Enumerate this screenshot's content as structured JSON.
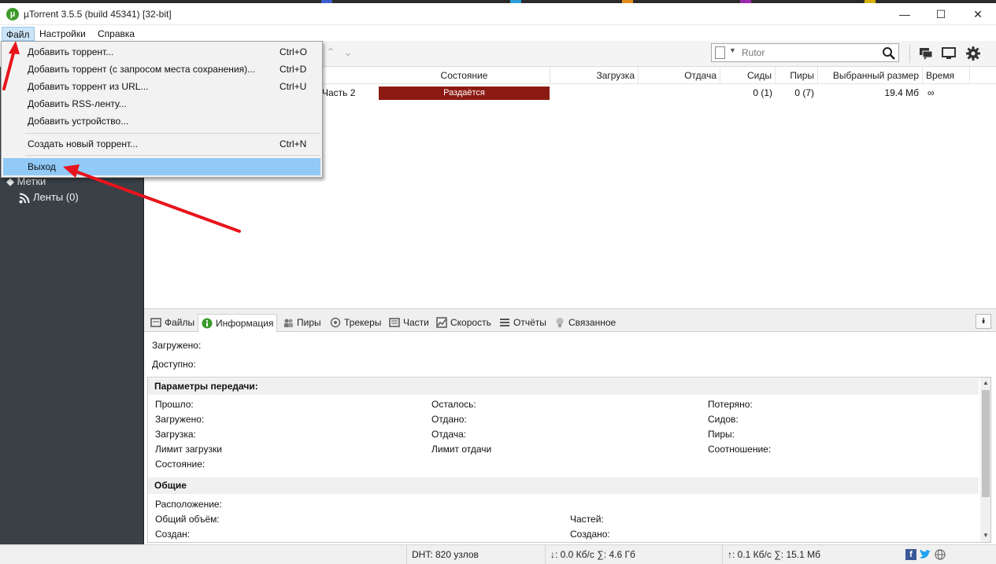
{
  "window": {
    "title": "µTorrent 3.5.5  (build 45341) [32-bit]",
    "minimize": "—",
    "maximize": "☐",
    "close": "✕"
  },
  "menubar": {
    "file": "Файл",
    "settings": "Настройки",
    "help": "Справка"
  },
  "file_menu": {
    "items": [
      {
        "label": "Добавить торрент...",
        "shortcut": "Ctrl+O"
      },
      {
        "label": "Добавить торрент (с запросом места сохранения)...",
        "shortcut": "Ctrl+D"
      },
      {
        "label": "Добавить торрент из URL...",
        "shortcut": "Ctrl+U"
      },
      {
        "label": "Добавить RSS-ленту...",
        "shortcut": ""
      },
      {
        "label": "Добавить устройство...",
        "shortcut": ""
      },
      {
        "label": "Создать новый торрент...",
        "shortcut": "Ctrl+N"
      },
      {
        "label": "Выход",
        "shortcut": ""
      }
    ]
  },
  "search": {
    "placeholder": "Rutor"
  },
  "sidebar": {
    "labels": "Метки",
    "feeds": "Ленты (0)"
  },
  "torrent_list": {
    "columns": {
      "state": "Состояние",
      "download": "Загрузка",
      "upload": "Отдача",
      "seeds": "Сиды",
      "peers": "Пиры",
      "size": "Выбранный размер",
      "time": "Время"
    },
    "row": {
      "name": "Часть 2",
      "state": "Раздаётся",
      "seeds": "0 (1)",
      "peers": "0 (7)",
      "size": "19.4 Мб",
      "time": "∞"
    }
  },
  "tabs": [
    "Файлы",
    "Информация",
    "Пиры",
    "Трекеры",
    "Части",
    "Скорость",
    "Отчёты",
    "Связанное"
  ],
  "info": {
    "downloaded": "Загружено:",
    "available": "Доступно:",
    "transfer_header": "Параметры передачи:",
    "col1": [
      "Прошло:",
      "Загружено:",
      "Загрузка:",
      "Лимит загрузки",
      "Состояние:"
    ],
    "col2": [
      "Осталось:",
      "Отдано:",
      "Отдача:",
      "Лимит отдачи"
    ],
    "col3": [
      "Потеряно:",
      "Сидов:",
      "Пиры:",
      "Соотношение:"
    ],
    "general_header": "Общие",
    "gen_col1": [
      "Расположение:",
      "Общий объём:",
      "Создан:"
    ],
    "gen_col2": [
      "Частей:",
      "Создано:"
    ]
  },
  "statusbar": {
    "dht": "DHT: 820 узлов",
    "down": "↓: 0.0 Кб/с ∑: 4.6 Гб",
    "up": "↑: 0.1 Кб/с ∑: 15.1 Мб"
  },
  "colors": {
    "sidebar": "#394147",
    "seeding": "#8b1a12",
    "highlight": "#91c9f7",
    "arrow": "#e8141c"
  }
}
